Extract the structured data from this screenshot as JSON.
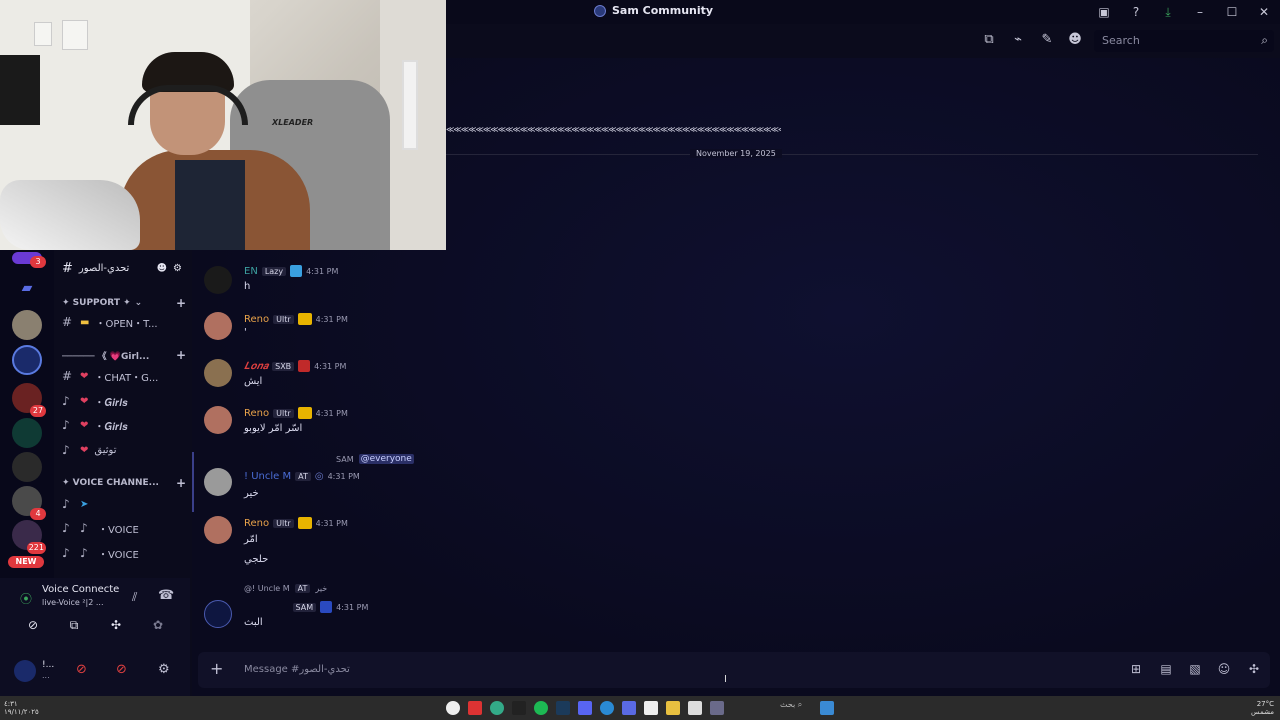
{
  "titlebar": {
    "title": "Sam Community"
  },
  "toolbar": {
    "search_placeholder": "Search"
  },
  "channel_list": {
    "current": "تحدي-الصور",
    "categories": [
      {
        "label": "✦ SUPPORT ✦"
      },
      {
        "label": "────── 《 💗Girl..."
      },
      {
        "label": "✦ VOICE CHANNE..."
      }
    ],
    "channels": [
      {
        "name": "・OPEN・T..."
      },
      {
        "name": "・CHAT・G..."
      },
      {
        "name": "・𝑮𝒊𝒓𝒍𝒔"
      },
      {
        "name": "・𝑮𝒊𝒓𝒍𝒔"
      },
      {
        "name": "توثيق"
      },
      {
        "name": ""
      },
      {
        "name": "・VOICE"
      },
      {
        "name": "・VOICE"
      }
    ]
  },
  "servers": {
    "badges": [
      "3",
      "27",
      "4",
      "221"
    ],
    "new_label": "NEW"
  },
  "voice": {
    "status": "Voice Connecte",
    "channel": "live-Voice ²|2 ..."
  },
  "user": {
    "name": "!...",
    "status": "..."
  },
  "chat": {
    "banner_text": "≪≪≪≪≪≪≪≪≪≪≪≪≪≪≪≪≪≪≪≪≪≪≪≪≪≪≪≪≪≪≪≪≪≪≪≪≪≪≪≪≪≪≪≪≪≪≪≪≪≪≪≪≪≪≪≪≪≪≪≪≪≪≫",
    "date_divider": "November 19, 2025",
    "messages": [
      {
        "author": "EN",
        "tag": "Lazy",
        "time": "4:31 PM",
        "text": "h"
      },
      {
        "author": "Reno",
        "tag": "Ultr",
        "time": "4:31 PM",
        "text": "'"
      },
      {
        "author": "𝑳𝒐𝒏𝒂",
        "tag": "SXB",
        "time": "4:31 PM",
        "text": "ايش"
      },
      {
        "author": "Reno",
        "tag": "Ultr",
        "time": "4:31 PM",
        "text": "اسّر امّر لايوبو"
      },
      {
        "author": "! Uncle M",
        "tag": "AT",
        "time": "4:31 PM",
        "text": "خير",
        "reply_author": "SAM",
        "reply_text": "@everyone"
      },
      {
        "author": "Reno",
        "tag": "Ultr",
        "time": "4:31 PM",
        "text": "امّر",
        "text2": "حلجي"
      },
      {
        "author": "SAM",
        "tag": "SAM",
        "time": "4:31 PM",
        "text": "البث",
        "reply_author": "@! Uncle M",
        "reply_tag": "AT",
        "reply_text": "خير"
      }
    ]
  },
  "composer": {
    "placeholder": "Message #تحدي-الصور"
  },
  "taskbar": {
    "search": "بحث",
    "weather": "27°C",
    "weather_sub": "مشمس",
    "time": "٤:٣١",
    "date": "١٩/١١/٢٠٢٥"
  },
  "colors": {
    "reno": "#e8a24a",
    "lona": "#e04040",
    "uncle": "#4a6cd4",
    "en": "#3ca0a0",
    "sam": "#2a4ac0"
  }
}
